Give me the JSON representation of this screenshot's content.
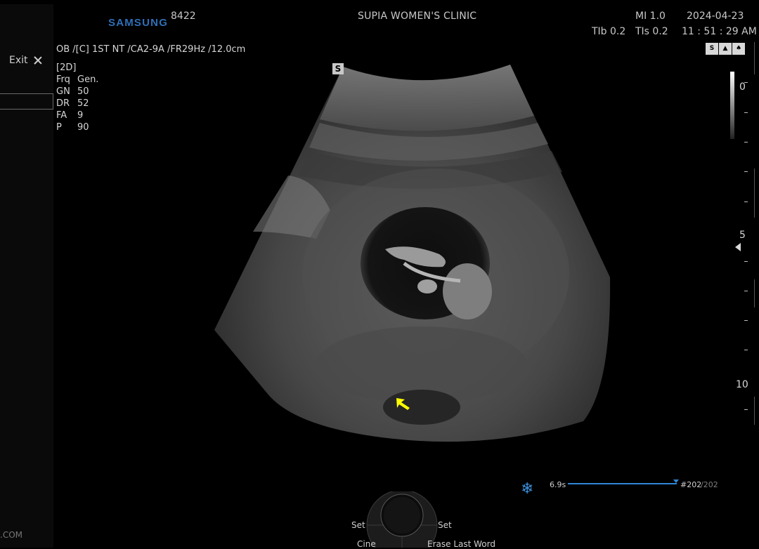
{
  "header": {
    "brand": "SAMSUNG",
    "unit_number": "8422",
    "clinic": "SUPIA WOMEN'S CLINIC",
    "mi": "MI  1.0",
    "date": "2024-04-23",
    "tib": "TIb 0.2",
    "tis": "TIs 0.2",
    "time": "11 : 51 : 29 AM",
    "preset": "OB /[C] 1ST NT /CA2-9A /FR29Hz /12.0cm"
  },
  "left_panel": {
    "exit_label": "Exit",
    "footer_text": ".COM"
  },
  "params": {
    "mode": "[2D]",
    "rows": [
      {
        "key": "Frq",
        "value": "Gen."
      },
      {
        "key": "GN",
        "value": "50"
      },
      {
        "key": "DR",
        "value": "52"
      },
      {
        "key": "FA",
        "value": "9"
      },
      {
        "key": "P",
        "value": "90"
      }
    ]
  },
  "status_icons": [
    "S HAR",
    "probe-icon",
    "fetal-icon"
  ],
  "image": {
    "s_badge": "S"
  },
  "depth_scale": {
    "labels": [
      "0",
      "5",
      "10"
    ]
  },
  "cine": {
    "duration": "6.9s",
    "frame_current": "#202",
    "frame_total": "/202",
    "progress": 1.0
  },
  "trackball": {
    "set_left": "Set",
    "set_right": "Set",
    "cine": "Cine",
    "erase": "Erase Last Word"
  },
  "colors": {
    "brand": "#2f6fb8",
    "accent": "#2f86d6",
    "arrow": "#ffff00"
  }
}
